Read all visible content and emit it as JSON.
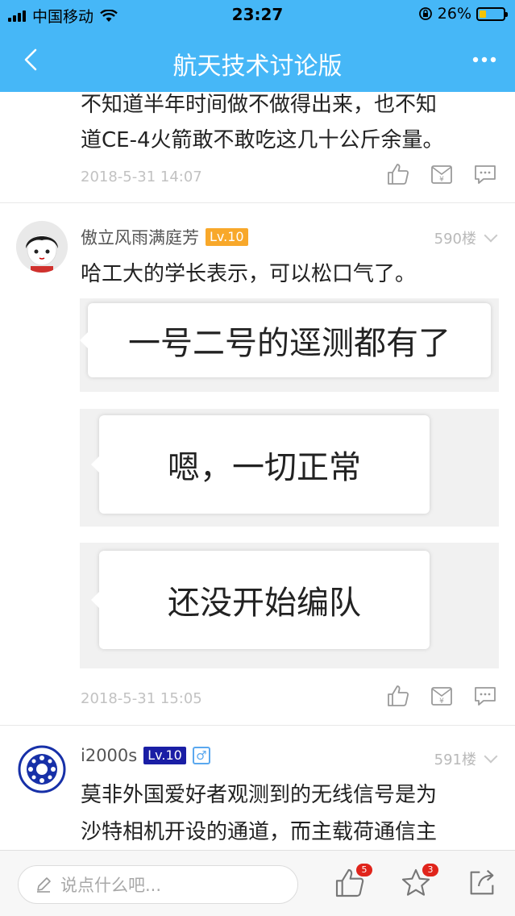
{
  "status": {
    "carrier": "中国移动",
    "time": "23:27",
    "battery": "26%"
  },
  "nav": {
    "title": "航天技术讨论版"
  },
  "prev_post": {
    "text_line1": "不知道半年时间做不做得出来，也不知",
    "text_line2": "道CE-4火箭敢不敢吃这几十公斤余量。",
    "time": "2018-5-31 14:07"
  },
  "post_590": {
    "username": "傲立风雨满庭芳",
    "level": "Lv.10",
    "floor": "590楼",
    "text": "哈工大的学长表示，可以松口气了。",
    "images": [
      "一号二号的逕测都有了",
      "嗯，一切正常",
      "还没开始编队"
    ],
    "time": "2018-5-31 15:05"
  },
  "post_591": {
    "username": "i2000s",
    "level": "Lv.10",
    "gender": "♂",
    "floor": "591楼",
    "text_line1": "莫非外国爱好者观测到的无线信号是为",
    "text_line2": "沙特相机开设的通道，而主载荷通信主"
  },
  "bottom": {
    "placeholder": "说点什么吧...",
    "like_badge": "5",
    "star_badge": "3"
  },
  "colors": {
    "brand": "#46b7f7",
    "badge": "#e0241b",
    "lv_orange": "#f8a82a",
    "lv_navy": "#1a1ea5"
  }
}
